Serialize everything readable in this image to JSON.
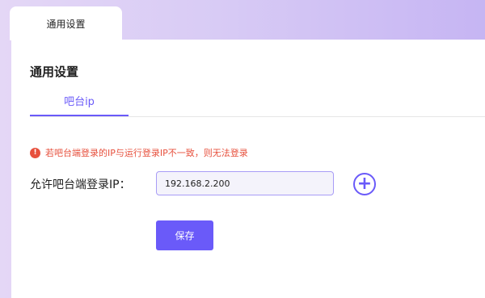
{
  "top_tab": {
    "label": "通用设置"
  },
  "page": {
    "title": "通用设置"
  },
  "sub_tabs": [
    {
      "label": "吧台ip"
    }
  ],
  "notice": {
    "icon": "info-icon",
    "text": "若吧台端登录的IP与运行登录IP不一致，则无法登录"
  },
  "form": {
    "ip_label": "允许吧台端登录IP：",
    "ip_value": "192.168.2.200",
    "add_icon": "plus-circle-icon",
    "save_label": "保存"
  },
  "colors": {
    "accent": "#6a5af9",
    "error": "#e7503d"
  }
}
